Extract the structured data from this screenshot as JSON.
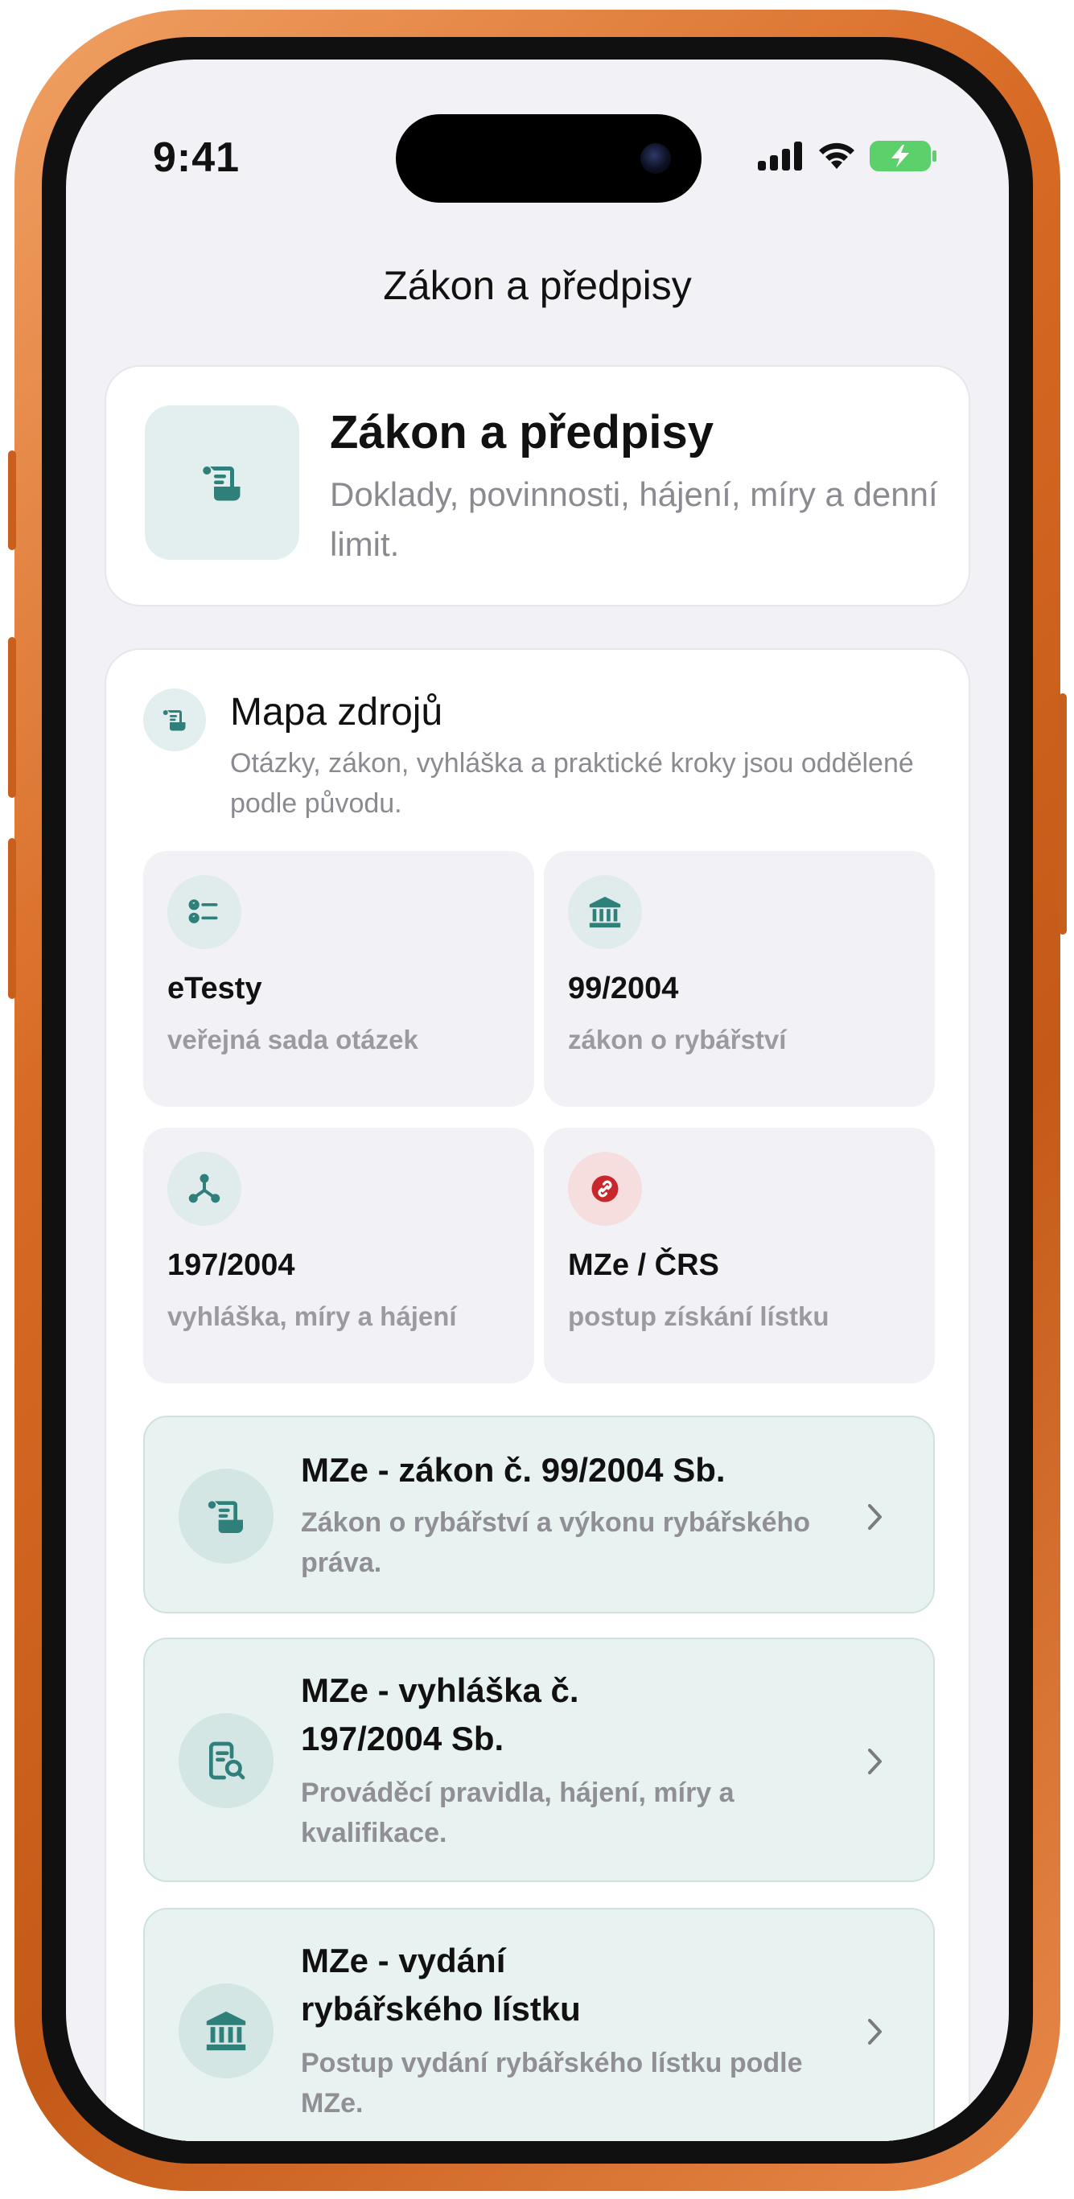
{
  "status_bar": {
    "time": "9:41"
  },
  "nav": {
    "title": "Zákon a předpisy"
  },
  "hero": {
    "title": "Zákon a předpisy",
    "subtitle": "Doklady, povinnosti, hájení, míry a denní limit."
  },
  "sources": {
    "title": "Mapa zdrojů",
    "subtitle": "Otázky, zákon, vyhláška a praktické kroky jsou oddělené podle původu.",
    "tiles": [
      {
        "icon": "checklist-icon",
        "title": "eTesty",
        "subtitle": "veřejná sada otázek"
      },
      {
        "icon": "bank-icon",
        "title": "99/2004",
        "subtitle": "zákon o rybářství"
      },
      {
        "icon": "nodes-icon",
        "title": "197/2004",
        "subtitle": "vyhláška, míry a hájení"
      },
      {
        "icon": "link-icon",
        "title": "MZe / ČRS",
        "subtitle": "postup získání lístku"
      }
    ],
    "links": [
      {
        "icon": "scroll-icon",
        "title": "MZe - zákon č. 99/2004 Sb.",
        "subtitle": "Zákon o rybářství a výkonu rybářského práva."
      },
      {
        "icon": "document-search-icon",
        "title": "MZe - vyhláška č. 197/2004 Sb.",
        "subtitle": "Prováděcí pravidla, hájení, míry a kvalifikace."
      },
      {
        "icon": "bank-icon",
        "title": "MZe - vydání rybářského lístku",
        "subtitle": "Postup vydání rybářského lístku podle MZe."
      }
    ]
  },
  "colors": {
    "accent": "#2f7f7b",
    "accent_bg": "#e2efee",
    "link_bg": "#e8f2f1",
    "frame": "#d76a24",
    "red": "#c8282c"
  }
}
